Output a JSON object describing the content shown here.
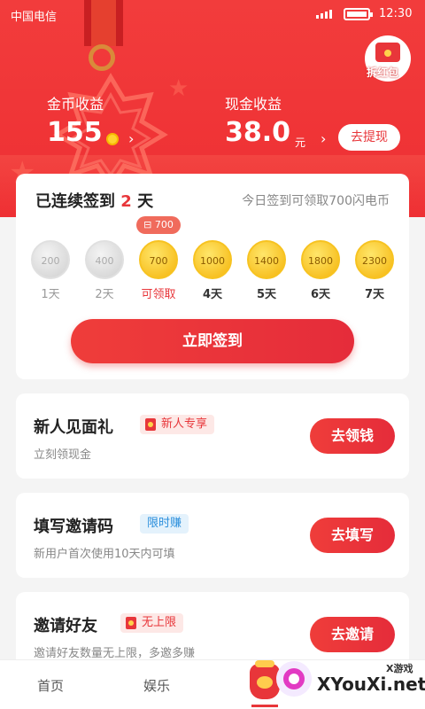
{
  "status_bar": {
    "carrier": "中国电信",
    "time": "12:30"
  },
  "header": {
    "hongbao_label": "拆红包",
    "coin": {
      "title": "金币收益",
      "value": "155"
    },
    "cash": {
      "title": "现金收益",
      "value": "38.0",
      "unit": "元",
      "withdraw_label": "去提现"
    }
  },
  "signin": {
    "title_prefix": "已连续签到",
    "streak": "2",
    "title_suffix": "天",
    "hint": "今日签到可领取700闪电币",
    "bubble": "700",
    "days": [
      {
        "amount": "200",
        "label": "1天",
        "state": "done"
      },
      {
        "amount": "400",
        "label": "2天",
        "state": "done"
      },
      {
        "amount": "700",
        "label": "可领取",
        "state": "today"
      },
      {
        "amount": "1000",
        "label": "4天",
        "state": "future"
      },
      {
        "amount": "1400",
        "label": "5天",
        "state": "future"
      },
      {
        "amount": "1800",
        "label": "6天",
        "state": "future"
      },
      {
        "amount": "2300",
        "label": "7天",
        "state": "future"
      }
    ],
    "button": "立即签到"
  },
  "tasks": [
    {
      "title": "新人见面礼",
      "tag": "新人专享",
      "tag_color": "red",
      "sub": "立刻领现金",
      "button": "去领钱"
    },
    {
      "title": "填写邀请码",
      "tag": "限时赚",
      "tag_color": "blue",
      "sub": "新用户首次使用10天内可填",
      "button": "去填写"
    },
    {
      "title": "邀请好友",
      "tag": "无上限",
      "tag_color": "red",
      "sub": "邀请好友数量无上限，多邀多赚",
      "button": "去邀请"
    }
  ],
  "tabbar": {
    "tab1": "首页",
    "tab2": "娱乐"
  },
  "watermark": {
    "small": "X游戏",
    "big": "XYouXi.net"
  },
  "colors": {
    "primary": "#e8363a",
    "gold": "#f5b40a"
  }
}
